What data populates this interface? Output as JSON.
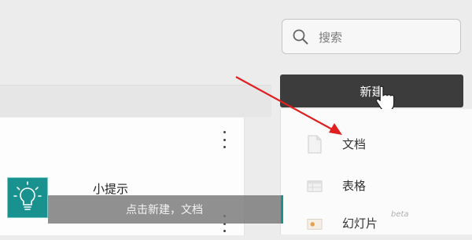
{
  "search": {
    "placeholder": "搜索",
    "icon": "search-icon"
  },
  "new_button": {
    "label": "新建"
  },
  "new_menu": {
    "items": [
      {
        "label": "文档",
        "icon": "document-icon"
      },
      {
        "label": "表格",
        "icon": "spreadsheet-icon"
      },
      {
        "label": "幻灯片",
        "icon": "slides-icon",
        "badge": "beta"
      }
    ]
  },
  "tip": {
    "title": "小提示",
    "message": "点击新建，文档",
    "icon": "lightbulb-icon"
  },
  "colors": {
    "accent": "#19918e",
    "arrow": "#e02020",
    "button_bg": "#3c3c3c"
  }
}
